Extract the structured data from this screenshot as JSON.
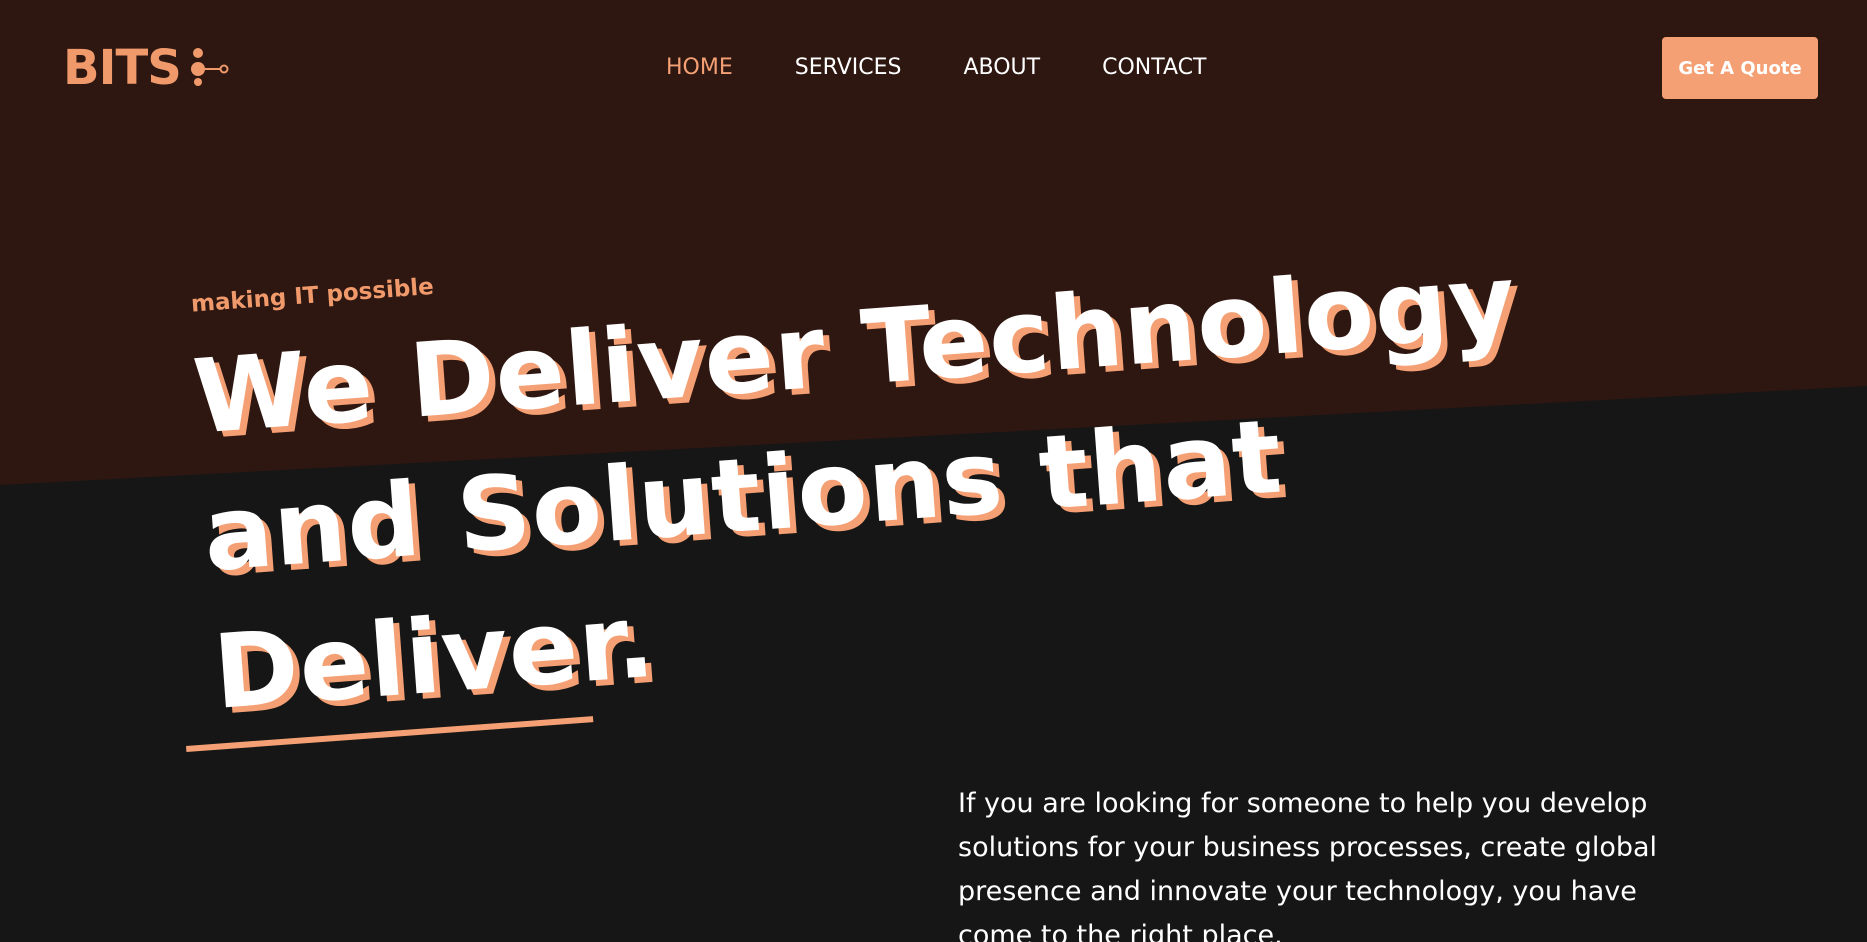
{
  "header": {
    "logo_text": "BITS",
    "logo_icon": "molecule-icon",
    "nav": [
      {
        "label": "HOME",
        "active": true
      },
      {
        "label": "SERVICES",
        "active": false
      },
      {
        "label": "ABOUT",
        "active": false
      },
      {
        "label": "CONTACT",
        "active": false
      }
    ],
    "cta_label": "Get A Quote"
  },
  "hero": {
    "tagline": "making IT possible",
    "headline_lines": [
      "We Deliver Technology",
      "and Solutions that",
      "Deliver."
    ],
    "intro": "If you are looking for someone to help you develop solutions for your business processes, create global presence and innovate your technology, you have come to the right place."
  },
  "colors": {
    "accent": "#f4a074",
    "top_band": "#2e1711",
    "background": "#161616",
    "text": "#ffffff"
  }
}
